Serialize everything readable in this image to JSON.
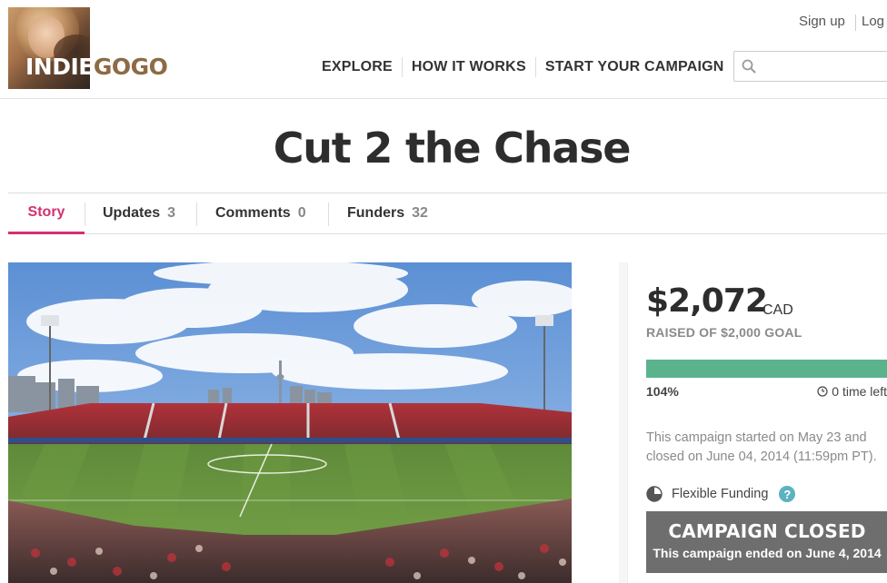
{
  "brand": {
    "logo_part1": "INDIE",
    "logo_part2": "GOGO"
  },
  "top_links": {
    "signup": "Sign up",
    "login": "Log"
  },
  "nav": {
    "explore": "EXPLORE",
    "how_it_works": "HOW IT WORKS",
    "start_campaign": "START YOUR CAMPAIGN"
  },
  "search": {
    "value": "",
    "placeholder": ""
  },
  "campaign": {
    "title": "Cut 2 the Chase"
  },
  "tabs": [
    {
      "label": "Story",
      "count": ""
    },
    {
      "label": "Updates",
      "count": "3"
    },
    {
      "label": "Comments",
      "count": "0"
    },
    {
      "label": "Funders",
      "count": "32"
    }
  ],
  "funding": {
    "amount": "$2,072",
    "currency": "CAD",
    "raised_of_goal": "RAISED OF $2,000 GOAL",
    "progress_fraction": 1.0,
    "percent_text": "104%",
    "time_left": "0 time left",
    "started_text": "This campaign started on May 23 and closed on June 04, 2014 (11:59pm PT).",
    "flexible_funding": "Flexible Funding",
    "help_glyph": "?",
    "closed_title": "CAMPAIGN CLOSED",
    "closed_sub": "This campaign ended on June 4, 2014"
  },
  "colors": {
    "accent": "#d3316e",
    "progress": "#5bb38e",
    "help": "#5bb3c0",
    "closed_bg": "#6e6e6e",
    "logo_gogo": "#8d6b45"
  },
  "icons": {
    "search": "search-icon",
    "clock": "clock-icon",
    "flexible": "pie-half-icon",
    "help": "help-icon"
  }
}
